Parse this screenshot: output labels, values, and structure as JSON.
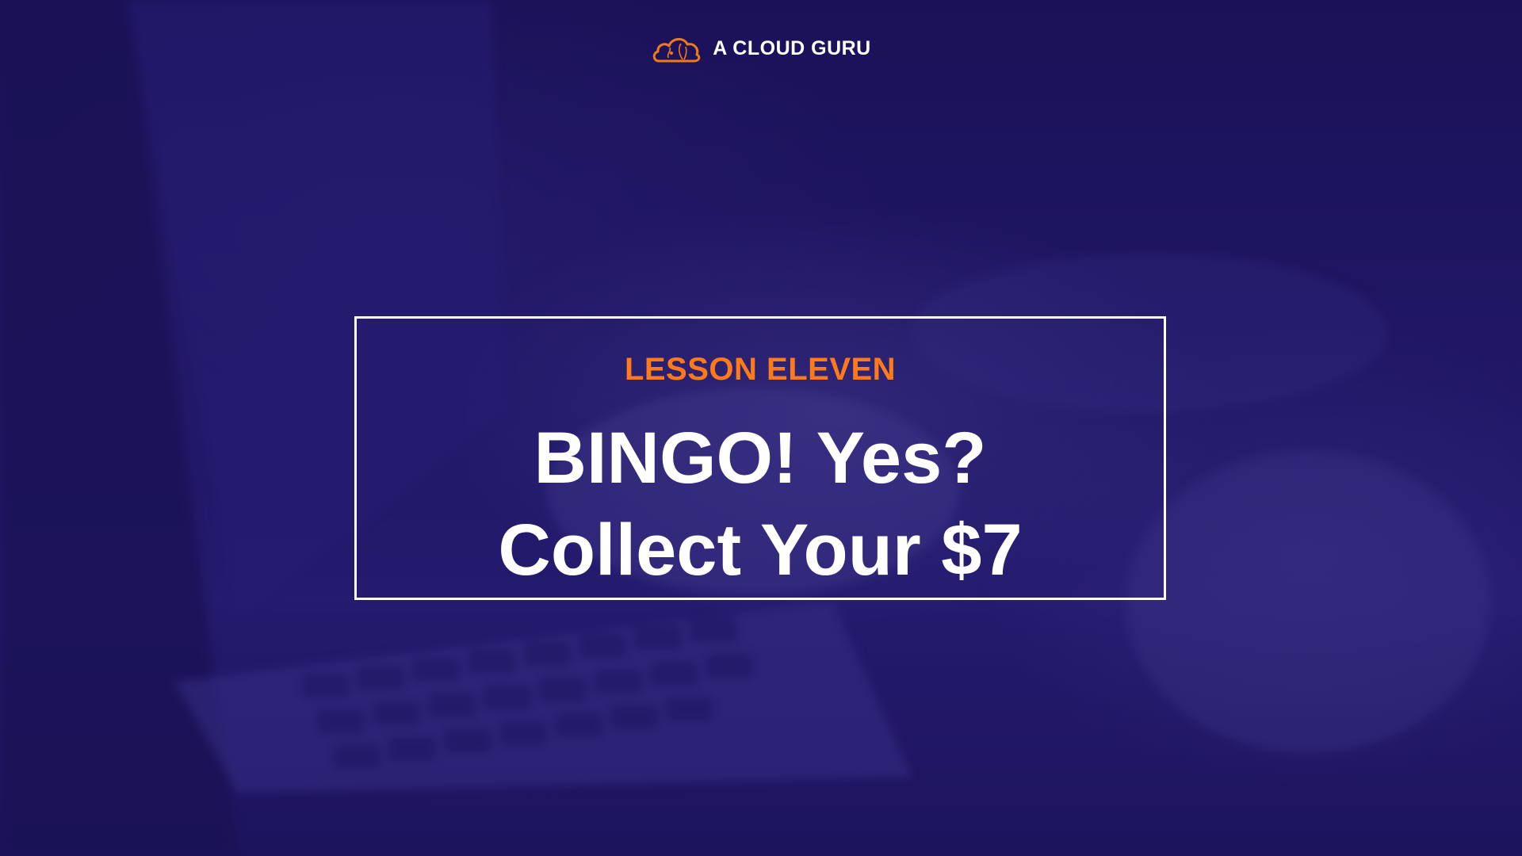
{
  "brand": {
    "name": "A CLOUD GURU",
    "logo_icon": "cloud-logo-icon",
    "logo_color": "#f07a1c"
  },
  "slide": {
    "lesson_label": "LESSON ELEVEN",
    "title_lines": [
      "BINGO! Yes?",
      "Collect Your $7"
    ]
  },
  "colors": {
    "background": "#1f1760",
    "accent": "#ff7a1a",
    "border": "#ffffff"
  }
}
